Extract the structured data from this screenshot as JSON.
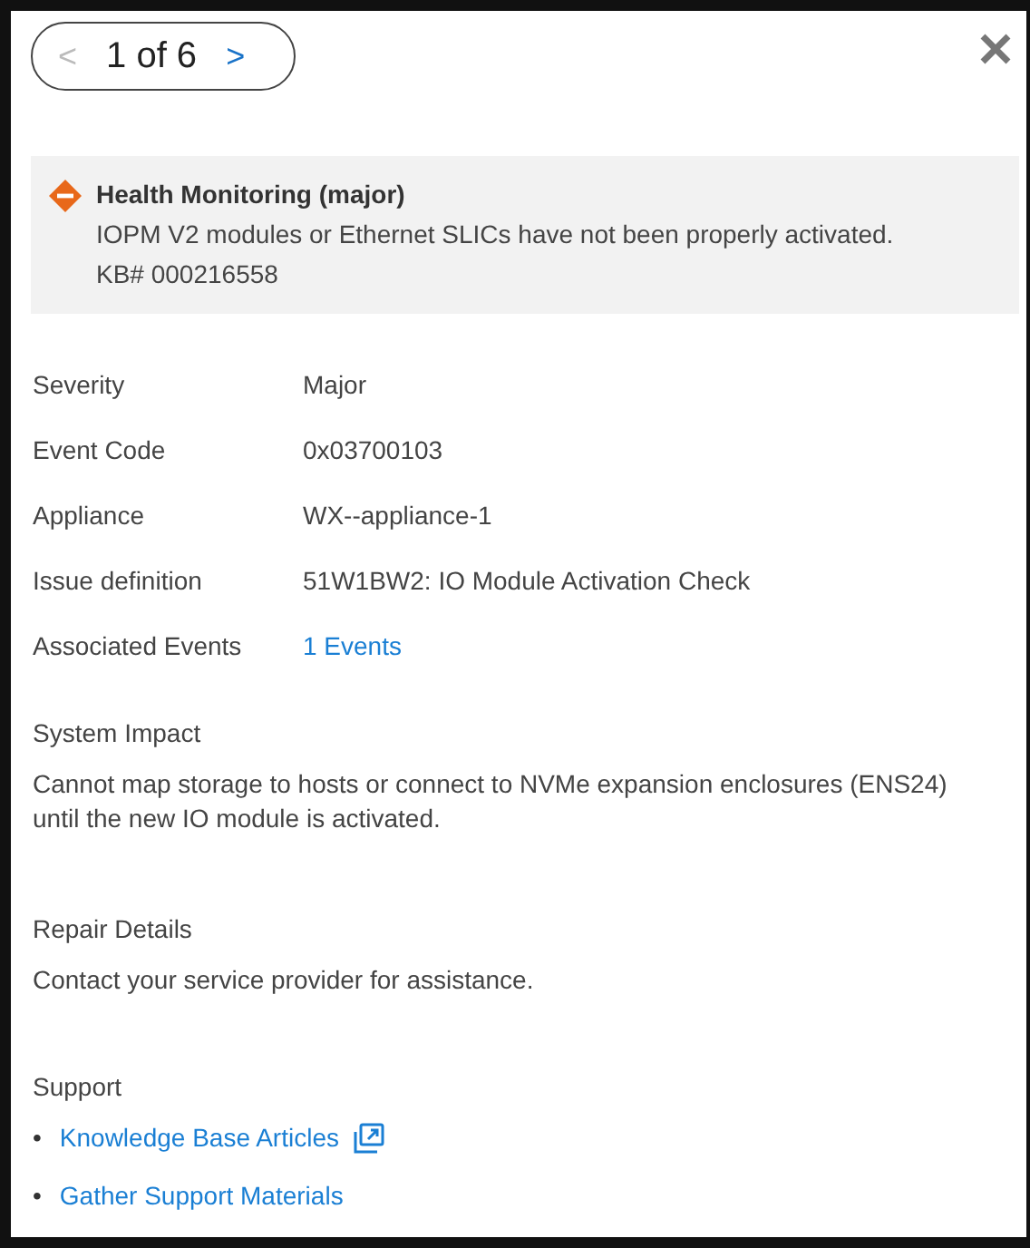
{
  "pager": {
    "prev": {
      "label": "<",
      "disabled": true
    },
    "current": "1 of 6",
    "next": {
      "label": ">",
      "disabled": false
    }
  },
  "alert": {
    "color": "#e8681a",
    "title": "Health Monitoring (major)",
    "message": "IOPM V2 modules or Ethernet SLICs have not been properly activated.",
    "kb": "KB# 000216558"
  },
  "details": [
    {
      "label": "Severity",
      "value": "Major",
      "kind": "text"
    },
    {
      "label": "Event Code",
      "value": "0x03700103",
      "kind": "text"
    },
    {
      "label": "Appliance",
      "value": "WX--appliance-1",
      "kind": "text"
    },
    {
      "label": "Issue definition",
      "value": "51W1BW2: IO Module Activation Check",
      "kind": "text"
    },
    {
      "label": "Associated Events",
      "value": "1 Events",
      "kind": "link"
    }
  ],
  "sections": [
    {
      "title": "System Impact",
      "text": "Cannot map storage to hosts or connect to NVMe expansion enclosures (ENS24) until the new IO module is activated."
    },
    {
      "title": "Repair Details",
      "text": "Contact your service provider for assistance."
    }
  ],
  "support": {
    "title": "Support",
    "links": [
      {
        "bullet": "•",
        "label": "Knowledge Base Articles",
        "external": true
      },
      {
        "bullet": "•",
        "label": "Gather Support Materials",
        "external": false
      }
    ]
  }
}
